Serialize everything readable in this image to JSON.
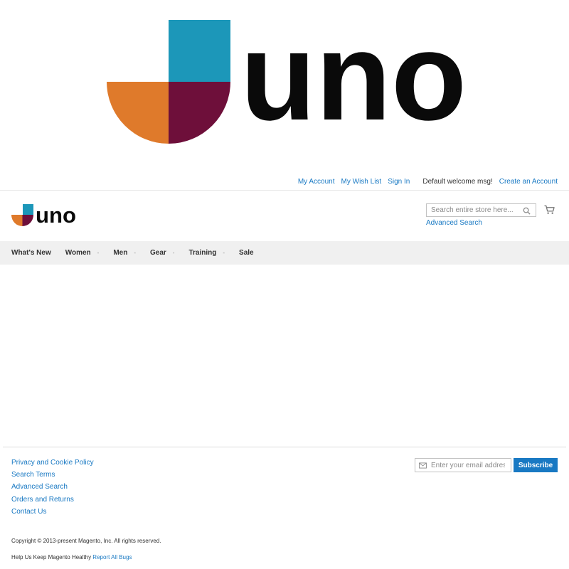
{
  "logo": {
    "text": "uno",
    "colors": {
      "teal": "#1c97b9",
      "orange": "#df7a2b",
      "maroon": "#6e0f3a",
      "text": "#0a0a0a"
    }
  },
  "header": {
    "links": [
      {
        "label": "My Account"
      },
      {
        "label": "My Wish List"
      },
      {
        "label": "Sign In"
      }
    ],
    "welcome": "Default welcome msg!",
    "create_account": "Create an Account"
  },
  "search": {
    "placeholder": "Search entire store here...",
    "icon": "search-icon",
    "advanced_label": "Advanced Search"
  },
  "cart": {
    "icon": "cart-icon"
  },
  "nav": {
    "items": [
      {
        "label": "What's New",
        "caret": ""
      },
      {
        "label": "Women",
        "caret": "-"
      },
      {
        "label": "Men",
        "caret": "-"
      },
      {
        "label": "Gear",
        "caret": "-"
      },
      {
        "label": "Training",
        "caret": "-"
      },
      {
        "label": "Sale",
        "caret": ""
      }
    ]
  },
  "footer": {
    "links": [
      {
        "label": "Privacy and Cookie Policy"
      },
      {
        "label": "Search Terms"
      },
      {
        "label": "Advanced Search"
      },
      {
        "label": "Orders and Returns"
      },
      {
        "label": "Contact Us"
      }
    ],
    "newsletter": {
      "placeholder": "Enter your email address",
      "subscribe_label": "Subscribe",
      "icon": "mail-icon"
    },
    "copyright": "Copyright © 2013-present Magento, Inc. All rights reserved.",
    "bugs_text": "Help Us Keep Magento Healthy",
    "bugs_link": "Report All Bugs"
  },
  "colors": {
    "link": "#1979c3",
    "nav_bg": "#f0f0f0",
    "button": "#1979c3"
  }
}
